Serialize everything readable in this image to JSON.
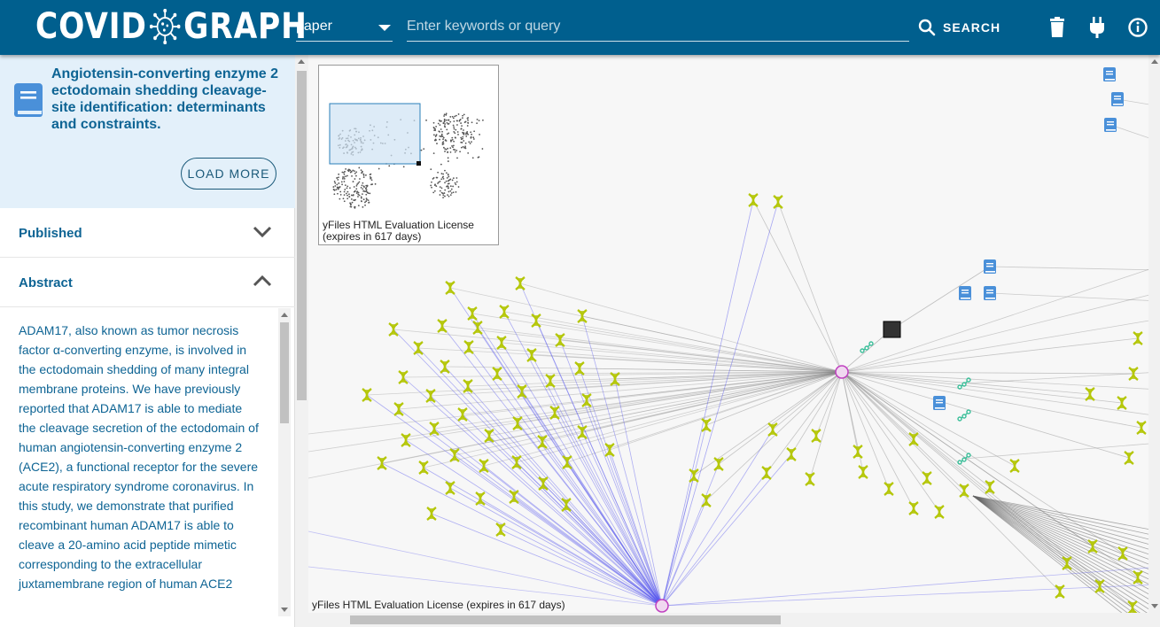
{
  "header": {
    "logo_left": "COVID",
    "logo_right": "GRAPH",
    "select_value": "paper",
    "search_placeholder": "Enter keywords or query",
    "search_label": "SEARCH"
  },
  "paper": {
    "title": "Angiotensin-converting enzyme 2 ectodomain shedding cleavage-site identification: determinants and constraints.",
    "load_more": "LOAD MORE"
  },
  "sections": {
    "published": "Published",
    "abstract": "Abstract"
  },
  "abstract_text": "ADAM17, also known as tumor necrosis factor α-converting enzyme, is involved in the ectodomain shedding of many integral membrane proteins. We have previously reported that ADAM17 is able to mediate the cleavage secretion of the ectodomain of human angiotensin-converting enzyme 2 (ACE2), a functional receptor for the severe acute respiratory syndrome coronavirus. In this study, we demonstrate that purified recombinant human ADAM17 is able to cleave a 20-amino acid peptide mimetic corresponding to the extracellular juxtamembrane region of human ACE2",
  "graph": {
    "overview_license": "yFiles HTML Evaluation License\n(expires in 617 days)",
    "license_bottom": "yFiles HTML Evaluation License (expires in 617 days)"
  },
  "colors": {
    "header": "#005f8e",
    "title_text": "#0e6494",
    "gene": "#b5c70a",
    "paper_node": "#4a90d9",
    "pathway": "#3bbf9a",
    "disease_hub": "#c040c0",
    "edge_blue": "#5555ee",
    "edge_gray": "#888888"
  },
  "icons": {
    "logo": "virus-icon",
    "delete": "trash-icon",
    "plugin": "plug-icon",
    "info": "info-icon",
    "search": "search-icon",
    "paper": "book-icon"
  }
}
